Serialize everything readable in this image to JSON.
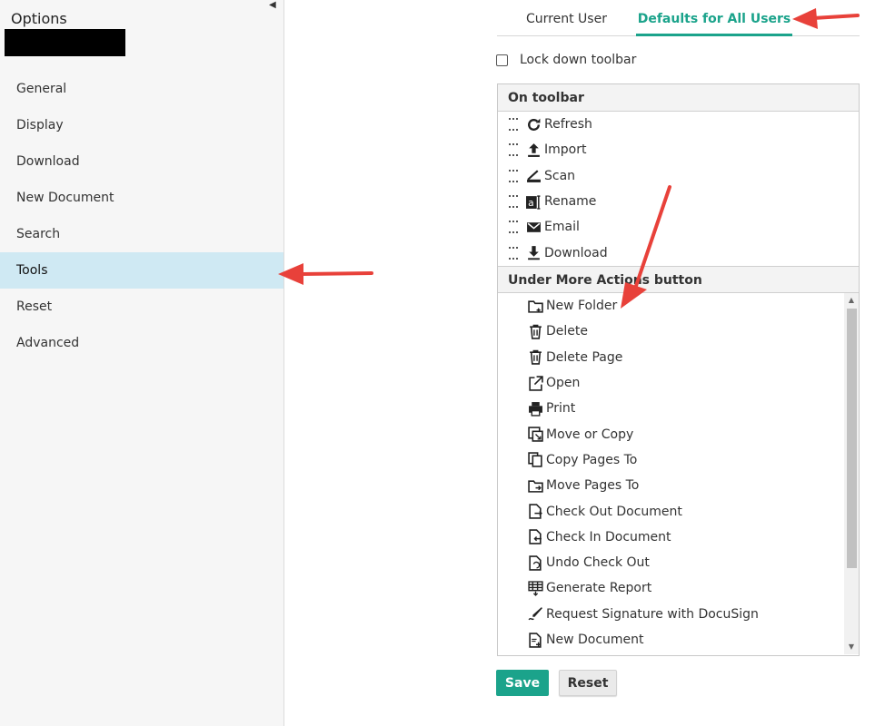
{
  "sidebar": {
    "title": "Options",
    "items": [
      {
        "label": "General"
      },
      {
        "label": "Display"
      },
      {
        "label": "Download"
      },
      {
        "label": "New Document"
      },
      {
        "label": "Search"
      },
      {
        "label": "Tools",
        "active": true
      },
      {
        "label": "Reset"
      },
      {
        "label": "Advanced"
      }
    ]
  },
  "tabs": {
    "current_user": "Current User",
    "defaults_all": "Defaults for All Users"
  },
  "lock_toolbar": {
    "label": "Lock down toolbar",
    "checked": false
  },
  "on_toolbar": {
    "heading": "On toolbar",
    "items": [
      {
        "label": "Refresh",
        "icon": "refresh-icon"
      },
      {
        "label": "Import",
        "icon": "import-icon"
      },
      {
        "label": "Scan",
        "icon": "scan-icon"
      },
      {
        "label": "Rename",
        "icon": "rename-icon"
      },
      {
        "label": "Email",
        "icon": "email-icon"
      },
      {
        "label": "Download",
        "icon": "download-icon"
      }
    ]
  },
  "more_actions": {
    "heading": "Under More Actions button",
    "items": [
      {
        "label": "New Folder",
        "icon": "new-folder-icon"
      },
      {
        "label": "Delete",
        "icon": "delete-icon"
      },
      {
        "label": "Delete Page",
        "icon": "delete-page-icon"
      },
      {
        "label": "Open",
        "icon": "open-icon"
      },
      {
        "label": "Print",
        "icon": "print-icon"
      },
      {
        "label": "Move or Copy",
        "icon": "move-copy-icon"
      },
      {
        "label": "Copy Pages To",
        "icon": "copy-pages-icon"
      },
      {
        "label": "Move Pages To",
        "icon": "move-pages-icon"
      },
      {
        "label": "Check Out Document",
        "icon": "check-out-icon"
      },
      {
        "label": "Check In Document",
        "icon": "check-in-icon"
      },
      {
        "label": "Undo Check Out",
        "icon": "undo-check-out-icon"
      },
      {
        "label": "Generate Report",
        "icon": "report-icon"
      },
      {
        "label": "Request Signature with DocuSign",
        "icon": "signature-icon"
      },
      {
        "label": "New Document",
        "icon": "new-document-icon"
      }
    ]
  },
  "buttons": {
    "save": "Save",
    "reset": "Reset"
  },
  "colors": {
    "accent": "#1ba38b",
    "active_nav": "#cfe9f3",
    "annotation_arrow": "#e8413a"
  }
}
